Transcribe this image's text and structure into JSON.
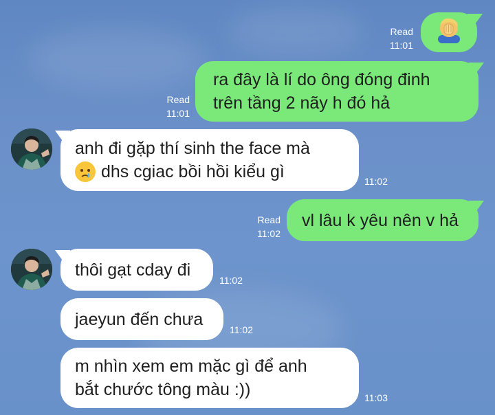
{
  "messages": {
    "m1": {
      "read": "Read",
      "time": "11:01"
    },
    "m2": {
      "read": "Read",
      "time": "11:01",
      "line1": "ra đây là lí do ông đóng đinh",
      "line2": "trên tầng 2 nãy h đó hả"
    },
    "m3": {
      "time": "11:02",
      "line1": "anh đi gặp thí sinh the face mà",
      "line2": "dhs cgiac bồi hồi kiểu gì"
    },
    "m4": {
      "read": "Read",
      "time": "11:02",
      "line1": "vl lâu k yêu nên v hả"
    },
    "m5": {
      "time": "11:02",
      "line1": "thôi gạt cday đi"
    },
    "m6": {
      "time": "11:02",
      "line1": "jaeyun đến chưa"
    },
    "m7": {
      "time": "11:03",
      "line1": "m nhìn xem em mặc gì để anh",
      "line2": "bắt chước tông màu :))"
    }
  },
  "icons": {
    "sticker": "facepalm-emoji-icon",
    "inline_emoji": "crying-face-icon"
  },
  "colors": {
    "outgoing_bubble": "#7ae97a",
    "incoming_bubble": "#ffffff",
    "background": "#6b90c9"
  }
}
